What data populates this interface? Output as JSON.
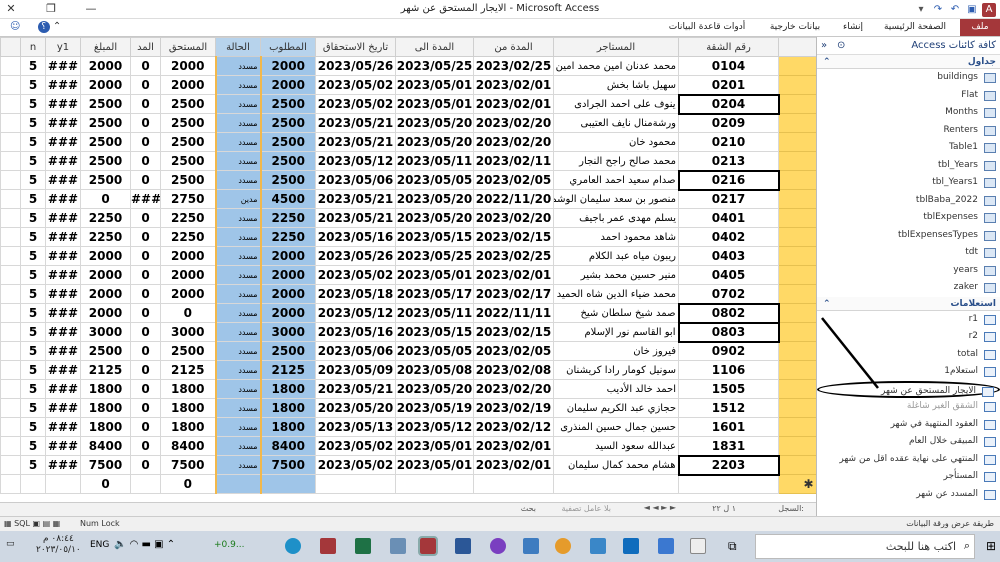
{
  "window": {
    "title": "الايجار المستحق عن شهر - Microsoft Access"
  },
  "ribbon": {
    "tabs": [
      "ملف",
      "الصفحة الرئيسية",
      "إنشاء",
      "بيانات خارجية",
      "أدوات قاعدة البيانات"
    ],
    "search_hint": "؟"
  },
  "grid": {
    "columns": [
      "n",
      "y1",
      "المبلغ",
      "المد",
      "المستحق",
      "الحالة",
      "المطلوب",
      "تاريخ الاستحقاق",
      "المدة الى",
      "المدة من",
      "المستاجر",
      "رقم الشقة"
    ],
    "rows": [
      {
        "n": "5",
        "y1": "###",
        "amount": "2000",
        "mad": "0",
        "due": "2000",
        "status": "مسدد",
        "req": "2000",
        "due_date": "2023/05/26",
        "to": "2023/05/25",
        "from": "2023/02/25",
        "tenant": "محمد عدنان امين محمد امين",
        "apt": "0104"
      },
      {
        "n": "5",
        "y1": "###",
        "amount": "2000",
        "mad": "0",
        "due": "2000",
        "status": "مسدد",
        "req": "2000",
        "due_date": "2023/05/02",
        "to": "2023/05/01",
        "from": "2023/02/01",
        "tenant": "سهيل باشا بخش",
        "apt": "0201"
      },
      {
        "n": "5",
        "y1": "###",
        "amount": "2500",
        "mad": "0",
        "due": "2500",
        "status": "مسدد",
        "req": "2500",
        "due_date": "2023/05/02",
        "to": "2023/05/01",
        "from": "2023/02/01",
        "tenant": "ينوف على احمد الجرادى",
        "apt": "0204"
      },
      {
        "n": "5",
        "y1": "###",
        "amount": "2500",
        "mad": "0",
        "due": "2500",
        "status": "مسدد",
        "req": "2500",
        "due_date": "2023/05/21",
        "to": "2023/05/20",
        "from": "2023/02/20",
        "tenant": "ورشةمنال نايف العتيبى",
        "apt": "0209"
      },
      {
        "n": "5",
        "y1": "###",
        "amount": "2500",
        "mad": "0",
        "due": "2500",
        "status": "مسدد",
        "req": "2500",
        "due_date": "2023/05/21",
        "to": "2023/05/20",
        "from": "2023/02/20",
        "tenant": "محمود خان",
        "apt": "0210"
      },
      {
        "n": "5",
        "y1": "###",
        "amount": "2500",
        "mad": "0",
        "due": "2500",
        "status": "مسدد",
        "req": "2500",
        "due_date": "2023/05/12",
        "to": "2023/05/11",
        "from": "2023/02/11",
        "tenant": "محمد صالح راجح النجار",
        "apt": "0213"
      },
      {
        "n": "5",
        "y1": "###",
        "amount": "2500",
        "mad": "0",
        "due": "2500",
        "status": "مسدد",
        "req": "2500",
        "due_date": "2023/05/06",
        "to": "2023/05/05",
        "from": "2023/02/05",
        "tenant": "صدام سعيد احمد العامري",
        "apt": "0216"
      },
      {
        "n": "5",
        "y1": "###",
        "amount": "0",
        "mad": "###",
        "due": "2750",
        "status": "مدين",
        "req": "4500",
        "due_date": "2023/05/21",
        "to": "2023/05/20",
        "from": "2022/11/20",
        "tenant": "منصور بن سعد سليمان الوشمي",
        "apt": "0217"
      },
      {
        "n": "5",
        "y1": "###",
        "amount": "2250",
        "mad": "0",
        "due": "2250",
        "status": "مسدد",
        "req": "2250",
        "due_date": "2023/05/21",
        "to": "2023/05/20",
        "from": "2023/02/20",
        "tenant": "يسلم مهدى عمر باجيف",
        "apt": "0401"
      },
      {
        "n": "5",
        "y1": "###",
        "amount": "2250",
        "mad": "0",
        "due": "2250",
        "status": "مسدد",
        "req": "2250",
        "due_date": "2023/05/16",
        "to": "2023/05/15",
        "from": "2023/02/15",
        "tenant": "شاهد محمود احمد",
        "apt": "0402"
      },
      {
        "n": "5",
        "y1": "###",
        "amount": "2000",
        "mad": "0",
        "due": "2000",
        "status": "مسدد",
        "req": "2000",
        "due_date": "2023/05/26",
        "to": "2023/05/25",
        "from": "2023/02/25",
        "tenant": "ريبون مياه عبد الكلام",
        "apt": "0403"
      },
      {
        "n": "5",
        "y1": "###",
        "amount": "2000",
        "mad": "0",
        "due": "2000",
        "status": "مسدد",
        "req": "2000",
        "due_date": "2023/05/02",
        "to": "2023/05/01",
        "from": "2023/02/01",
        "tenant": "منير حسين محمد بشير",
        "apt": "0405"
      },
      {
        "n": "5",
        "y1": "###",
        "amount": "2000",
        "mad": "0",
        "due": "2000",
        "status": "مسدد",
        "req": "2000",
        "due_date": "2023/05/18",
        "to": "2023/05/17",
        "from": "2023/02/17",
        "tenant": "محمد ضياء الدين شاه الحميد",
        "apt": "0702"
      },
      {
        "n": "5",
        "y1": "###",
        "amount": "2000",
        "mad": "0",
        "due": "0",
        "status": "مسدد",
        "req": "2000",
        "due_date": "2023/05/12",
        "to": "2023/05/11",
        "from": "2022/11/11",
        "tenant": "صمد شيخ سلطان شيخ",
        "apt": "0802"
      },
      {
        "n": "5",
        "y1": "###",
        "amount": "3000",
        "mad": "0",
        "due": "3000",
        "status": "مسدد",
        "req": "3000",
        "due_date": "2023/05/16",
        "to": "2023/05/15",
        "from": "2023/02/15",
        "tenant": "ابو القاسم نور الإسلام",
        "apt": "0803"
      },
      {
        "n": "5",
        "y1": "###",
        "amount": "2500",
        "mad": "0",
        "due": "2500",
        "status": "مسدد",
        "req": "2500",
        "due_date": "2023/05/06",
        "to": "2023/05/05",
        "from": "2023/02/05",
        "tenant": "فيروز خان",
        "apt": "0902"
      },
      {
        "n": "5",
        "y1": "###",
        "amount": "2125",
        "mad": "0",
        "due": "2125",
        "status": "مسدد",
        "req": "2125",
        "due_date": "2023/05/09",
        "to": "2023/05/08",
        "from": "2023/02/08",
        "tenant": "سونيل كومار رادا كريشنان",
        "apt": "1106"
      },
      {
        "n": "5",
        "y1": "###",
        "amount": "1800",
        "mad": "0",
        "due": "1800",
        "status": "مسدد",
        "req": "1800",
        "due_date": "2023/05/21",
        "to": "2023/05/20",
        "from": "2023/02/20",
        "tenant": "احمد خالد الأديب",
        "apt": "1505"
      },
      {
        "n": "5",
        "y1": "###",
        "amount": "1800",
        "mad": "0",
        "due": "1800",
        "status": "مسدد",
        "req": "1800",
        "due_date": "2023/05/20",
        "to": "2023/05/19",
        "from": "2023/02/19",
        "tenant": "حجازي عبد الكريم سليمان",
        "apt": "1512"
      },
      {
        "n": "5",
        "y1": "###",
        "amount": "1800",
        "mad": "0",
        "due": "1800",
        "status": "مسدد",
        "req": "1800",
        "due_date": "2023/05/13",
        "to": "2023/05/12",
        "from": "2023/02/12",
        "tenant": "حسين جمال حسين المنذرى",
        "apt": "1601"
      },
      {
        "n": "5",
        "y1": "###",
        "amount": "8400",
        "mad": "0",
        "due": "8400",
        "status": "مسدد",
        "req": "8400",
        "due_date": "2023/05/02",
        "to": "2023/05/01",
        "from": "2023/02/01",
        "tenant": "عبدالله سعود السيد",
        "apt": "1831"
      },
      {
        "n": "5",
        "y1": "###",
        "amount": "7500",
        "mad": "0",
        "due": "7500",
        "status": "مسدد",
        "req": "7500",
        "due_date": "2023/05/02",
        "to": "2023/05/01",
        "from": "2023/02/01",
        "tenant": "هشام محمد كمال سليمان",
        "apt": "2203"
      }
    ],
    "new_row": {
      "amount": "0",
      "due": "0"
    }
  },
  "record_nav": {
    "label": "السجل:",
    "position": "١ ل ٢٢",
    "filter": "بلا عامل تصفية",
    "search": "بحث"
  },
  "statusbar": {
    "left": "Num Lock",
    "right": "طريقة عرض ورقة البيانات"
  },
  "nav": {
    "header": "كافة كائنات Access",
    "tables_group": "جداول",
    "tables": [
      "buildings",
      "Flat",
      "Months",
      "Renters",
      "Table1",
      "tbl_Years",
      "tbl_Years1",
      "tblBaba_2022",
      "tblExpenses",
      "tblExpensesTypes",
      "tdt",
      "years",
      "zaker"
    ],
    "queries_group": "استعلامات",
    "queries": [
      "r1",
      "r2",
      "total",
      "استعلام1",
      "الايجار المستحق عن شهر",
      "الشقق الغير شاغلة",
      "العقود المنتهية في شهر",
      "المبيقى خلال العام",
      "المنتهي على نهاية عقده اقل من شهر",
      "المستأجر",
      "المسدد عن شهر"
    ]
  },
  "taskbar": {
    "search": "اكتب هنا للبحث",
    "lang": "ENG",
    "time": "٠٨:٤٤ م",
    "date": "٢٠٢٣/٠٥/١٠",
    "stock": "+0.9..."
  }
}
